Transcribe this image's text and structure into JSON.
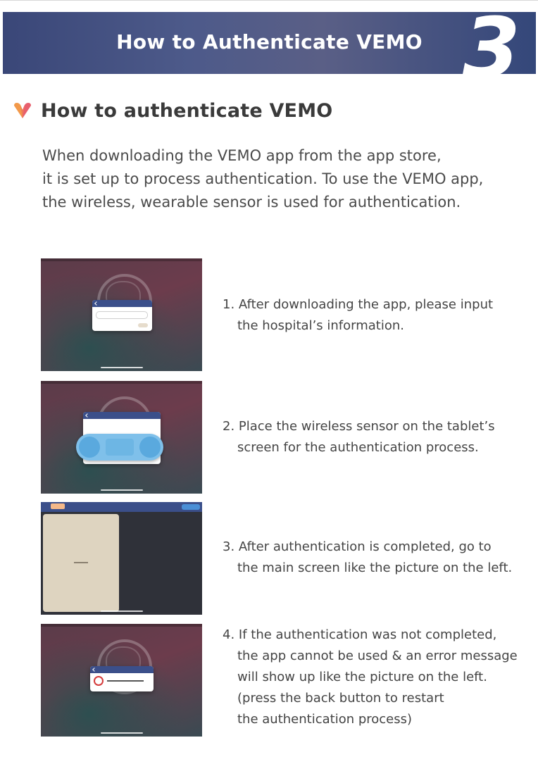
{
  "banner": {
    "title": "How to Authenticate VEMO",
    "number": "3"
  },
  "section": {
    "icon": "vemo-v-logo-icon",
    "heading": "How to authenticate VEMO"
  },
  "intro": {
    "lines": [
      "When downloading the VEMO app from the app store,",
      "it is set up to process authentication. To use the VEMO app,",
      "the wireless, wearable sensor is used for authentication."
    ]
  },
  "steps": [
    {
      "lines": [
        "1. After downloading the app, please input",
        "the hospital’s information."
      ]
    },
    {
      "lines": [
        "2. Place the wireless sensor on the tablet’s",
        "screen for the authentication process."
      ]
    },
    {
      "lines": [
        "3. After authentication is completed, go to",
        "the main screen like the picture on the left."
      ]
    },
    {
      "lines": [
        "4. If the authentication was not completed,",
        "the app cannot be used & an error message",
        "will show up like the picture on the left.",
        "(press the back button to restart",
        "the authentication process)"
      ]
    }
  ],
  "colors": {
    "banner": "#3a4778",
    "logo_orange": "#f2994a",
    "logo_pink": "#e8606e",
    "app_header": "#3b4f8a",
    "sensor_blue": "#7fc0ea"
  }
}
